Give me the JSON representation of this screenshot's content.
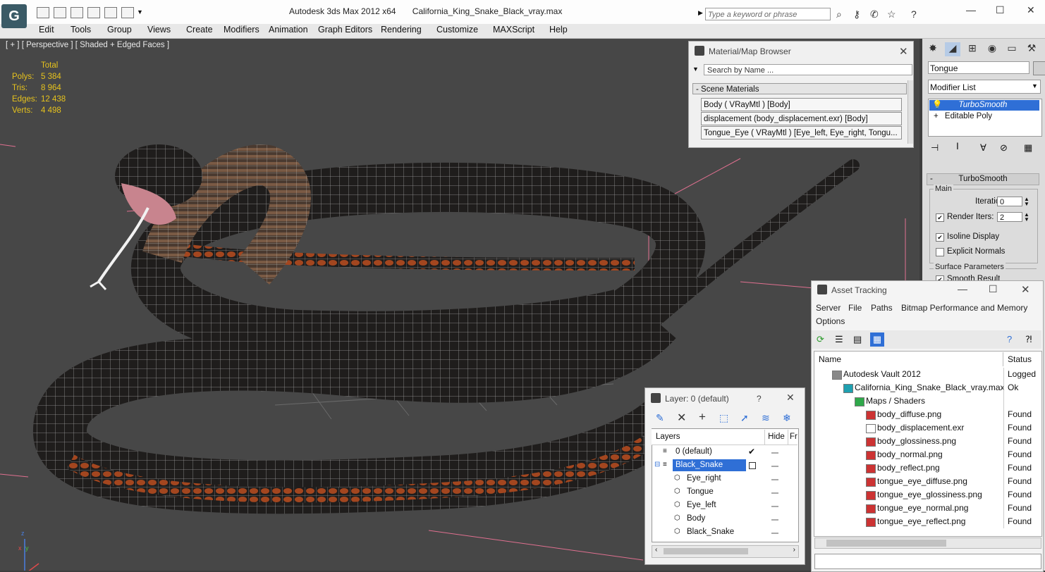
{
  "app": {
    "title": "Autodesk 3ds Max  2012 x64",
    "file": "California_King_Snake_Black_vray.max",
    "logo": "3ds-max-logo",
    "search_placeholder": "Type a keyword or phrase"
  },
  "menu": [
    "Edit",
    "Tools",
    "Group",
    "Views",
    "Create",
    "Modifiers",
    "Animation",
    "Graph Editors",
    "Rendering",
    "Customize",
    "MAXScript",
    "Help"
  ],
  "viewport": {
    "label": "[ + ] [ Perspective ] [ Shaded + Edged Faces ]",
    "stats_header": "Total",
    "stats": [
      {
        "label": "Polys:",
        "value": "5 384"
      },
      {
        "label": "Tris:",
        "value": "8 964"
      },
      {
        "label": "Edges:",
        "value": "12 438"
      },
      {
        "label": "Verts:",
        "value": "4 498"
      }
    ],
    "axis": {
      "x": "x",
      "y": "y",
      "z": "z"
    }
  },
  "material_browser": {
    "title": "Material/Map Browser",
    "search_placeholder": "Search by Name ...",
    "section": "- Scene Materials",
    "items": [
      "Body  ( VRayMtl )  [Body]",
      "displacement (body_displacement.exr) [Body]",
      "Tongue_Eye  ( VRayMtl )  [Eye_left, Eye_right, Tongu..."
    ]
  },
  "command_panel": {
    "object_name": "Tongue",
    "modifier_list": "Modifier List",
    "stack": [
      "TurboSmooth",
      "Editable Poly"
    ],
    "rollout_title": "TurboSmooth",
    "main_group": "Main",
    "iterations_label": "Iterations:",
    "iterations_value": "0",
    "render_iters_label": "Render Iters:",
    "render_iters_value": "2",
    "isoline_label": "Isoline Display",
    "explicit_label": "Explicit Normals",
    "surface_group": "Surface Parameters",
    "smooth_result_label": "Smooth Result"
  },
  "asset_tracking": {
    "title": "Asset Tracking",
    "menu": [
      "Server",
      "File",
      "Paths",
      "Bitmap Performance and Memory",
      "Options"
    ],
    "col_name": "Name",
    "col_status": "Status",
    "rows": [
      {
        "name": "Autodesk Vault 2012",
        "status": "Logged",
        "indent": 0,
        "icon": "vault-icon"
      },
      {
        "name": "California_King_Snake_Black_vray.max",
        "status": "Ok",
        "indent": 1,
        "icon": "max-file-icon"
      },
      {
        "name": "Maps / Shaders",
        "status": "",
        "indent": 2,
        "icon": "maps-icon"
      },
      {
        "name": "body_diffuse.png",
        "status": "Found",
        "indent": 3,
        "icon": "png-icon"
      },
      {
        "name": "body_displacement.exr",
        "status": "Found",
        "indent": 3,
        "icon": "exr-icon"
      },
      {
        "name": "body_glossiness.png",
        "status": "Found",
        "indent": 3,
        "icon": "png-icon"
      },
      {
        "name": "body_normal.png",
        "status": "Found",
        "indent": 3,
        "icon": "png-icon"
      },
      {
        "name": "body_reflect.png",
        "status": "Found",
        "indent": 3,
        "icon": "png-icon"
      },
      {
        "name": "tongue_eye_diffuse.png",
        "status": "Found",
        "indent": 3,
        "icon": "png-icon"
      },
      {
        "name": "tongue_eye_glossiness.png",
        "status": "Found",
        "indent": 3,
        "icon": "png-icon"
      },
      {
        "name": "tongue_eye_normal.png",
        "status": "Found",
        "indent": 3,
        "icon": "png-icon"
      },
      {
        "name": "tongue_eye_reflect.png",
        "status": "Found",
        "indent": 3,
        "icon": "png-icon"
      }
    ]
  },
  "layer_window": {
    "title": "Layer: 0 (default)",
    "help": "?",
    "col_layers": "Layers",
    "col_hide": "Hide",
    "col_freeze": "Fr",
    "rows": [
      {
        "name": "0 (default)",
        "indent": 0,
        "selected": false
      },
      {
        "name": "Black_Snake",
        "indent": 0,
        "selected": true
      },
      {
        "name": "Eye_right",
        "indent": 1,
        "selected": false
      },
      {
        "name": "Tongue",
        "indent": 1,
        "selected": false
      },
      {
        "name": "Eye_left",
        "indent": 1,
        "selected": false
      },
      {
        "name": "Body",
        "indent": 1,
        "selected": false
      },
      {
        "name": "Black_Snake",
        "indent": 1,
        "selected": false
      }
    ]
  },
  "colors": {
    "viewport_bg": "#474747",
    "stats": "#e6c21d",
    "selection": "#2f6fd6",
    "snake_dark": "#1d1b1a",
    "snake_belly": "#a24a22"
  }
}
